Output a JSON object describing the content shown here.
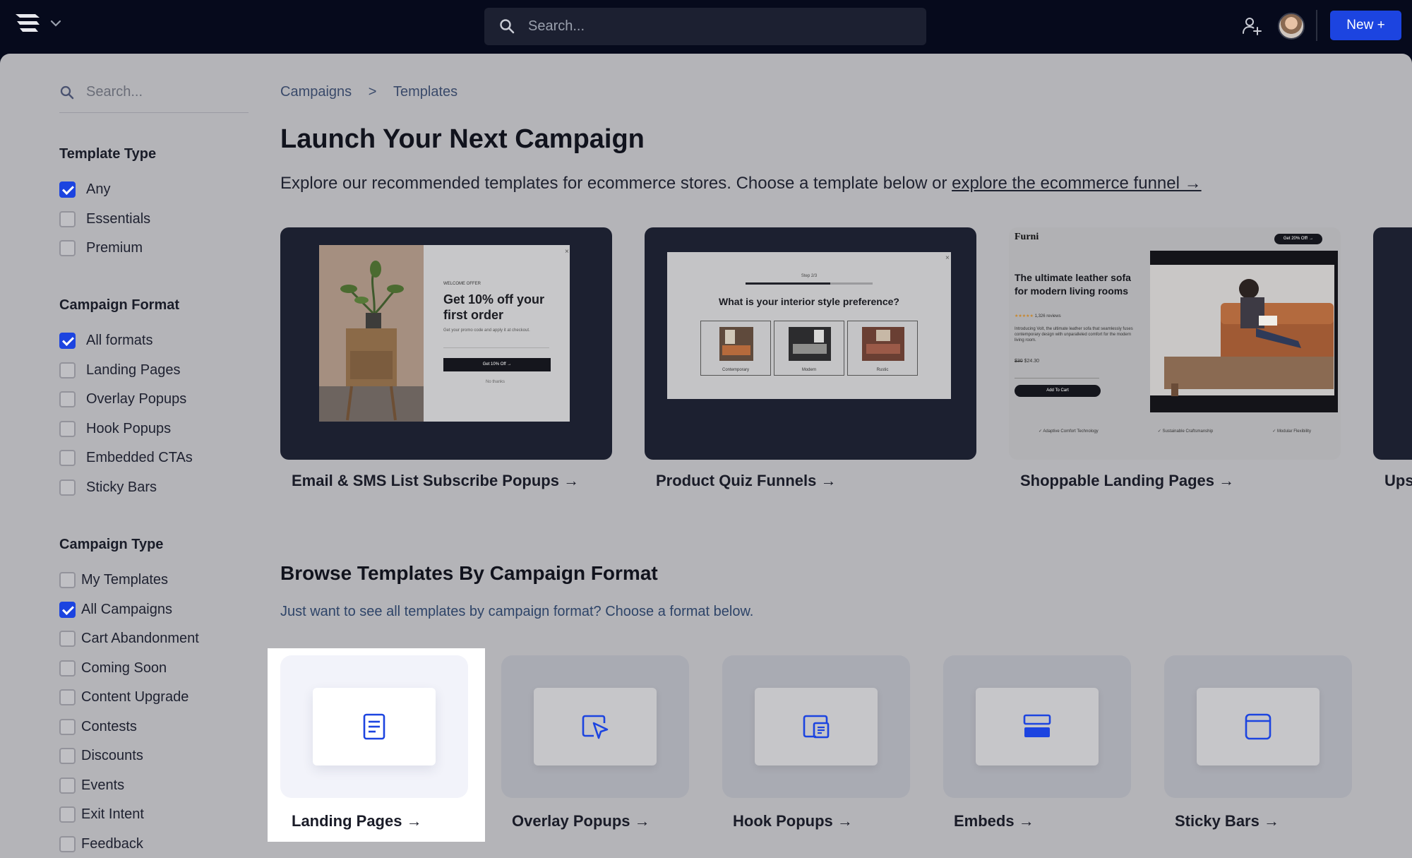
{
  "topbar": {
    "search_placeholder": "Search...",
    "new_button": "New +"
  },
  "sidebar": {
    "search_placeholder": "Search...",
    "template_type": {
      "heading": "Template Type",
      "options": [
        {
          "label": "Any",
          "checked": true
        },
        {
          "label": "Essentials",
          "checked": false
        },
        {
          "label": "Premium",
          "checked": false
        }
      ]
    },
    "campaign_format": {
      "heading": "Campaign Format",
      "options": [
        {
          "label": "All formats",
          "checked": true
        },
        {
          "label": "Landing Pages",
          "checked": false
        },
        {
          "label": "Overlay Popups",
          "checked": false
        },
        {
          "label": "Hook Popups",
          "checked": false
        },
        {
          "label": "Embedded CTAs",
          "checked": false
        },
        {
          "label": "Sticky Bars",
          "checked": false
        }
      ]
    },
    "campaign_type": {
      "heading": "Campaign Type",
      "options": [
        {
          "label": "My Templates",
          "checked": false
        },
        {
          "label": "All Campaigns",
          "checked": true
        },
        {
          "label": "Cart Abandonment",
          "checked": false
        },
        {
          "label": "Coming Soon",
          "checked": false
        },
        {
          "label": "Content Upgrade",
          "checked": false
        },
        {
          "label": "Contests",
          "checked": false
        },
        {
          "label": "Discounts",
          "checked": false
        },
        {
          "label": "Events",
          "checked": false
        },
        {
          "label": "Exit Intent",
          "checked": false
        },
        {
          "label": "Feedback",
          "checked": false
        }
      ]
    }
  },
  "breadcrumb": {
    "items": [
      "Campaigns",
      "Templates"
    ],
    "separator": ">"
  },
  "main": {
    "title": "Launch Your Next Campaign",
    "subtitle": "Explore our recommended templates for ecommerce stores. Choose a template below or",
    "subtitle_link": "explore the ecommerce funnel →",
    "featured": [
      {
        "label": "Email & SMS List Subscribe Popups →",
        "preview": {
          "eyebrow": "WELCOME OFFER",
          "headline": "Get 10% off your first order",
          "body": "Get your promo code and apply it at checkout.",
          "button": "Get 10% Off →",
          "dismiss": "No thanks"
        }
      },
      {
        "label": "Product Quiz Funnels →",
        "preview": {
          "step": "Step 2/3",
          "question": "What is your interior style preference?",
          "options": [
            "Contemporary",
            "Modern",
            "Rustic"
          ]
        }
      },
      {
        "label": "Shoppable Landing Pages →",
        "preview": {
          "brand": "Furni",
          "badge": "Get 20% Off! →",
          "headline": "The ultimate leather sofa for modern living rooms",
          "reviews": "1,326 reviews",
          "body": "Introducing Volt, the ultimate leather sofa that seamlessly fuses contemporary design with unparalleled comfort for the modern living room.",
          "old_price": "$30",
          "price": "$24.30",
          "button": "Add To Cart",
          "features": [
            "Adaptive Comfort Technology",
            "Sustainable Craftsmanship",
            "Modular Flexibility"
          ]
        }
      },
      {
        "label": "Ups"
      }
    ],
    "browse": {
      "heading": "Browse Templates By Campaign Format",
      "subheading": "Just want to see all templates by campaign format? Choose a format below.",
      "formats": [
        {
          "label": "Landing Pages →",
          "icon": "document-icon",
          "highlighted": true
        },
        {
          "label": "Overlay Popups →",
          "icon": "cursor-popup-icon"
        },
        {
          "label": "Hook Popups →",
          "icon": "hook-popup-icon"
        },
        {
          "label": "Embeds →",
          "icon": "embed-icon"
        },
        {
          "label": "Sticky Bars →",
          "icon": "sticky-bar-icon"
        }
      ]
    }
  },
  "colors": {
    "topbar_bg": "#060a1c",
    "accent": "#1c44e0",
    "overlay_panel": "#b4b4b8",
    "highlight": "#ffffff"
  }
}
